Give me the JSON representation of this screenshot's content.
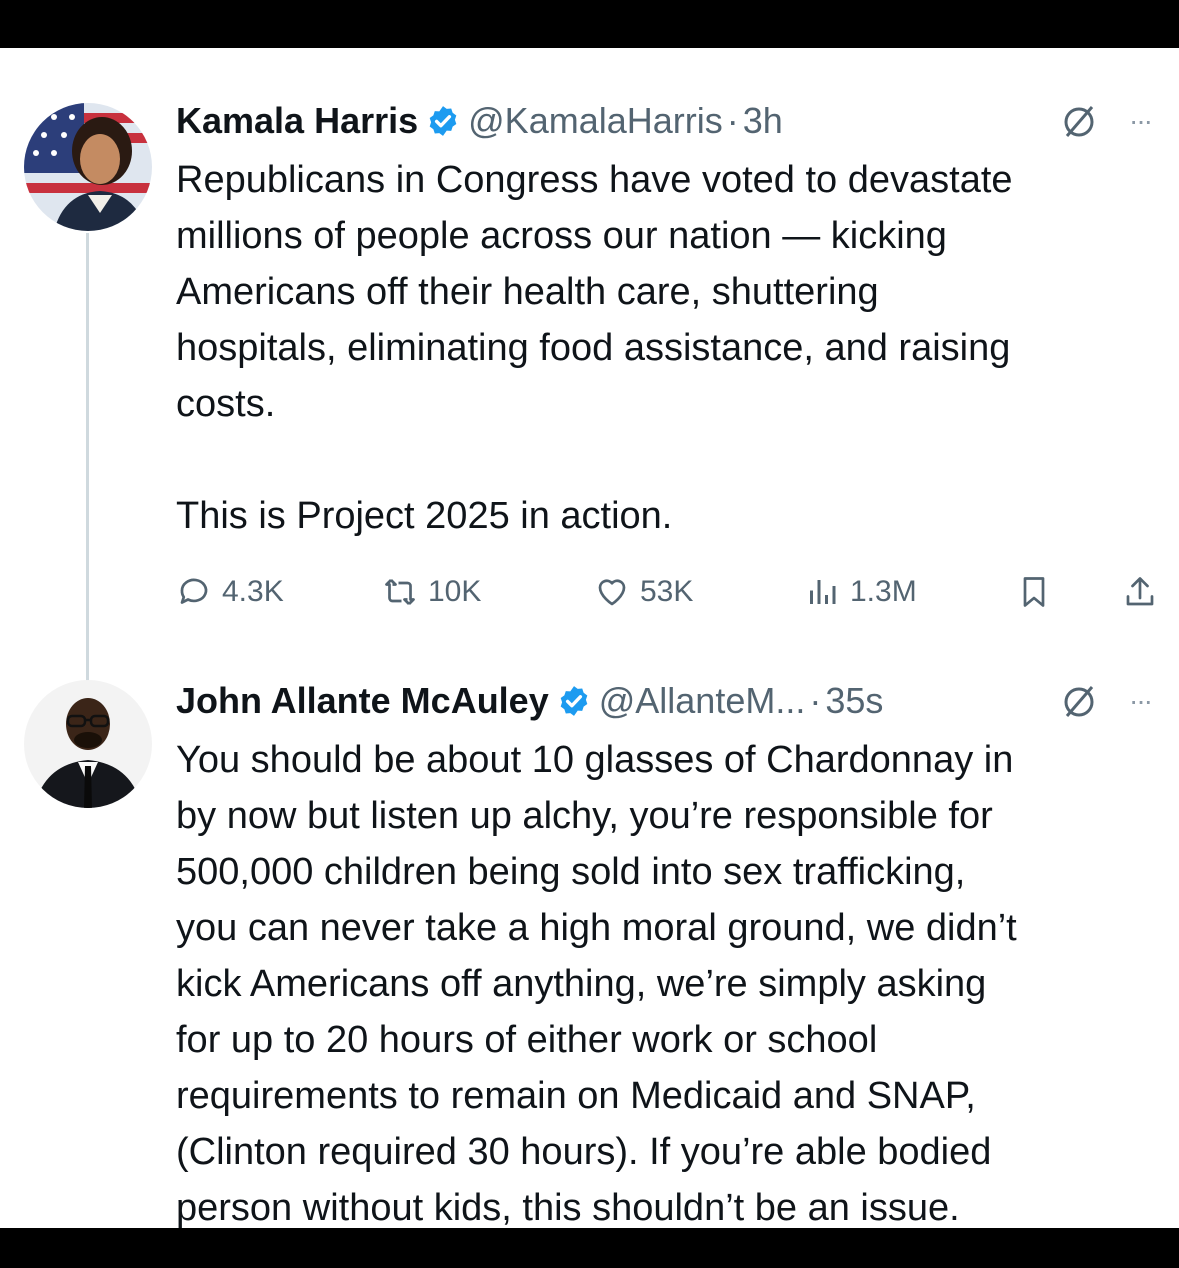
{
  "tweets": [
    {
      "name": "Kamala Harris",
      "handle": "@KamalaHarris",
      "separator": "·",
      "time": "3h",
      "more": "···",
      "lines": [
        "Republicans in Congress have voted to devastate",
        "millions of people across our nation — kicking",
        "Americans off their health care, shuttering",
        "hospitals, eliminating food assistance, and raising",
        "costs."
      ],
      "second_paragraph": "This is Project 2025 in action.",
      "stats": {
        "replies": "4.3K",
        "reposts": "10K",
        "likes": "53K",
        "views": "1.3M"
      }
    },
    {
      "name": "John Allante McAuley",
      "handle": "@AllanteM...",
      "separator": "·",
      "time": "35s",
      "more": "···",
      "lines": [
        "You should be about 10 glasses of Chardonnay in",
        "by now but listen up alchy, you’re responsible for",
        "500,000 children being sold into sex trafficking,",
        "you can never take a high moral ground, we didn’t",
        "kick Americans off anything, we’re simply asking",
        "for up to 20 hours of either work or school",
        "requirements to remain on Medicaid and SNAP,",
        "(Clinton required 30 hours). If you’re able bodied",
        "person without kids, this shouldn’t be an issue."
      ]
    }
  ],
  "colors": {
    "text": "#0f1419",
    "secondary": "#536471",
    "verified": "#1d9bf0",
    "background": "#ffffff",
    "frame": "#000000"
  },
  "icons": [
    "reply-icon",
    "repost-icon",
    "like-icon",
    "views-icon",
    "bookmark-icon",
    "share-icon",
    "grok-icon",
    "more-icon",
    "verified-badge-icon"
  ]
}
